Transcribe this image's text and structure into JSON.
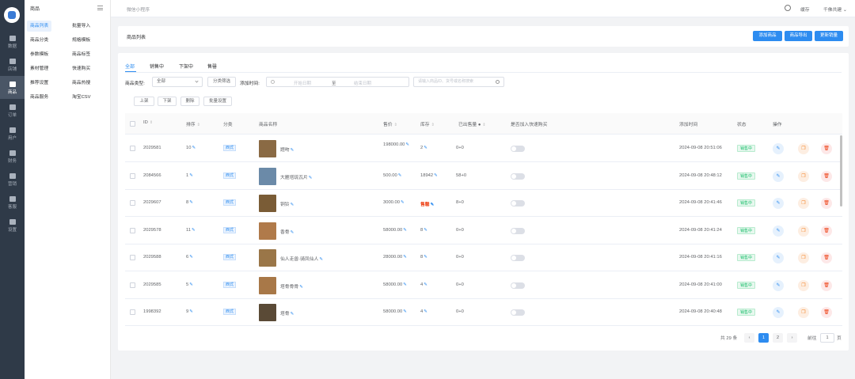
{
  "rail": {
    "items": [
      "数据",
      "店铺",
      "商品",
      "订单",
      "用户",
      "财务",
      "营销",
      "客服",
      "设置"
    ],
    "active_index": 2
  },
  "submenu": {
    "title": "商品",
    "left": [
      "商品列表",
      "商品分类",
      "参数模板",
      "素材管理",
      "推荐设置",
      "商品服务"
    ],
    "right": [
      "批量导入",
      "规格模板",
      "商品标签",
      "快速购买",
      "商品热搜",
      "淘宝CSV"
    ],
    "active": "商品列表"
  },
  "topbar": {
    "app_name": "微信小程序",
    "cache": "缓存",
    "user": "千佛共建"
  },
  "page": {
    "title": "商品列表",
    "buttons": [
      "添加商品",
      "商品导出",
      "更新销量"
    ]
  },
  "tabs": [
    {
      "label": "全部",
      "active": true
    },
    {
      "label": "销售中"
    },
    {
      "label": "下架中"
    },
    {
      "label": "售罄"
    }
  ],
  "filters": {
    "type_label": "商品类型:",
    "type_value": "全部",
    "category_button": "分类筛选",
    "time_label": "添加时间:",
    "date_start": "开始日期",
    "date_sep": "至",
    "date_end": "结束日期",
    "search_placeholder": "请输入商品ID、货号或名称搜索"
  },
  "actions": [
    "上架",
    "下架",
    "删除",
    "批量设置"
  ],
  "columns": [
    "ID",
    "排序",
    "分类",
    "商品名称",
    "售价",
    "库存",
    "已出售量",
    "是否加入快速购买",
    "添加时间",
    "状态",
    "操作"
  ],
  "rows": [
    {
      "id": "2029581",
      "sort": "10",
      "cat": "西式",
      "name": "题吻",
      "price": "198000.00",
      "stock": "2",
      "stock_red": false,
      "sold": "0+0",
      "time": "2024-09-08 20:51:06",
      "status": "销售中",
      "thumb": "#8a6a44"
    },
    {
      "id": "2084566",
      "sort": "1",
      "cat": "西式",
      "name": "大雁塔琉瓦片",
      "price": "500.00",
      "stock": "18942",
      "stock_red": false,
      "sold": "58+0",
      "time": "2024-09-08 20:48:12",
      "status": "销售中",
      "thumb": "#6b8aa8"
    },
    {
      "id": "2029607",
      "sort": "8",
      "cat": "西式",
      "name": "铜铃",
      "price": "3000.00",
      "stock": "售罄",
      "stock_red": true,
      "sold": "8+0",
      "time": "2024-09-08 20:41:46",
      "status": "销售中",
      "thumb": "#7a5c36"
    },
    {
      "id": "2029578",
      "sort": "11",
      "cat": "西式",
      "name": "香骨",
      "price": "58000.00",
      "stock": "8",
      "stock_red": false,
      "sold": "0+0",
      "time": "2024-09-08 20:41:24",
      "status": "销售中",
      "thumb": "#b07a4a"
    },
    {
      "id": "2029588",
      "sort": "6",
      "cat": "西式",
      "name": "仙人走兽·骑凤仙人",
      "price": "28000.00",
      "stock": "8",
      "stock_red": false,
      "sold": "0+0",
      "time": "2024-09-08 20:41:16",
      "status": "销售中",
      "thumb": "#9a7648"
    },
    {
      "id": "2029585",
      "sort": "5",
      "cat": "西式",
      "name": "塔骨骨骨",
      "price": "58000.00",
      "stock": "4",
      "stock_red": false,
      "sold": "0+0",
      "time": "2024-09-08 20:41:00",
      "status": "销售中",
      "thumb": "#a87848"
    },
    {
      "id": "1998392",
      "sort": "9",
      "cat": "西式",
      "name": "塔骨",
      "price": "58000.00",
      "stock": "4",
      "stock_red": false,
      "sold": "0+0",
      "time": "2024-09-08 20:40:48",
      "status": "销售中",
      "thumb": "#5a4a36"
    }
  ],
  "pagination": {
    "total": "共 29 条",
    "pages": [
      "1",
      "2"
    ],
    "current": "1",
    "goto_label": "前往",
    "goto_value": "1",
    "page_suffix": "页"
  }
}
